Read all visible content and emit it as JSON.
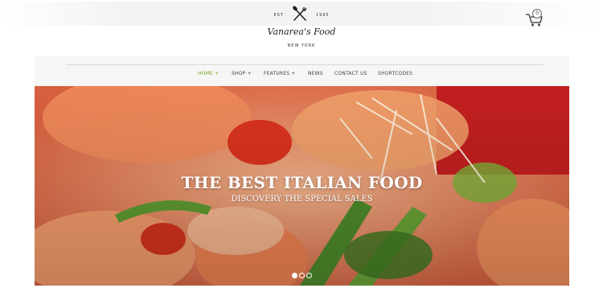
{
  "brand": {
    "est_label": "EST",
    "year": "1995",
    "name": "Vanarea's Food",
    "city": "NEW YORK"
  },
  "cart": {
    "count": "0",
    "icon": "cart-icon"
  },
  "nav": {
    "items": [
      {
        "label": "HOME +",
        "active": true
      },
      {
        "label": "SHOP +",
        "active": false
      },
      {
        "label": "FEATURES +",
        "active": false
      },
      {
        "label": "NEWS",
        "active": false
      },
      {
        "label": "CONTACT US",
        "active": false
      },
      {
        "label": "SHORTCODES",
        "active": false
      }
    ]
  },
  "hero": {
    "title": "THE BEST ITALIAN FOOD",
    "subtitle": "DISCOVERY THE SPECIAL SALES",
    "slide_count": 3,
    "active_slide": 1
  },
  "colors": {
    "accent": "#7aa52a",
    "text": "#444444"
  }
}
